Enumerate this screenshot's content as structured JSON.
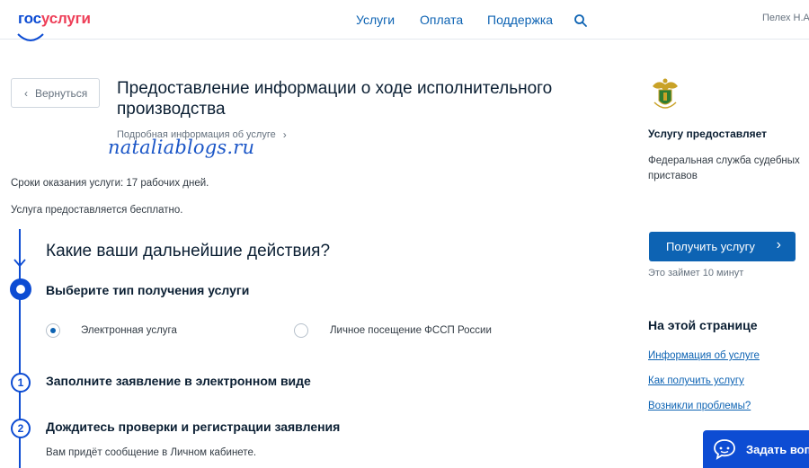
{
  "header": {
    "logo_part1": "гос",
    "logo_part2": "услуги",
    "nav": [
      "Услуги",
      "Оплата",
      "Поддержка"
    ],
    "search_icon": "search-icon",
    "user": "Пелех Н.А."
  },
  "back_label": "Вернуться",
  "service": {
    "title": "Предоставление информации о ходе исполнительного производства",
    "details_link": "Подробная информация об услуге",
    "terms": "Сроки оказания услуги: 17 рабочих дней.",
    "free": "Услуга предоставляется бесплатно."
  },
  "watermark": "nataliablogs.ru",
  "steps": {
    "heading": "Какие ваши дальнейшие действия?",
    "step0_title": "Выберите тип получения услуги",
    "options": [
      {
        "label": "Электронная услуга",
        "checked": true
      },
      {
        "label": "Личное посещение ФССП России",
        "checked": false
      }
    ],
    "step1_num": "1",
    "step1_title": "Заполните заявление в электронном виде",
    "step2_num": "2",
    "step2_title": "Дождитесь проверки и регистрации заявления",
    "step2_sub": "Вам придёт сообщение в Личном кабинете."
  },
  "sidebar": {
    "provider_heading": "Услугу предоставляет",
    "provider_name": "Федеральная служба судебных приставов",
    "get_button": "Получить услугу",
    "time_note": "Это займет 10 минут",
    "onpage_heading": "На этой странице",
    "links": [
      "Информация об услуге",
      "Как получить услугу",
      "Возникли проблемы?"
    ]
  },
  "ask_button": "Задать вопрос",
  "colors": {
    "brand_blue": "#0d4cd3",
    "brand_red": "#ee3f58",
    "link_blue": "#0d63b3"
  }
}
